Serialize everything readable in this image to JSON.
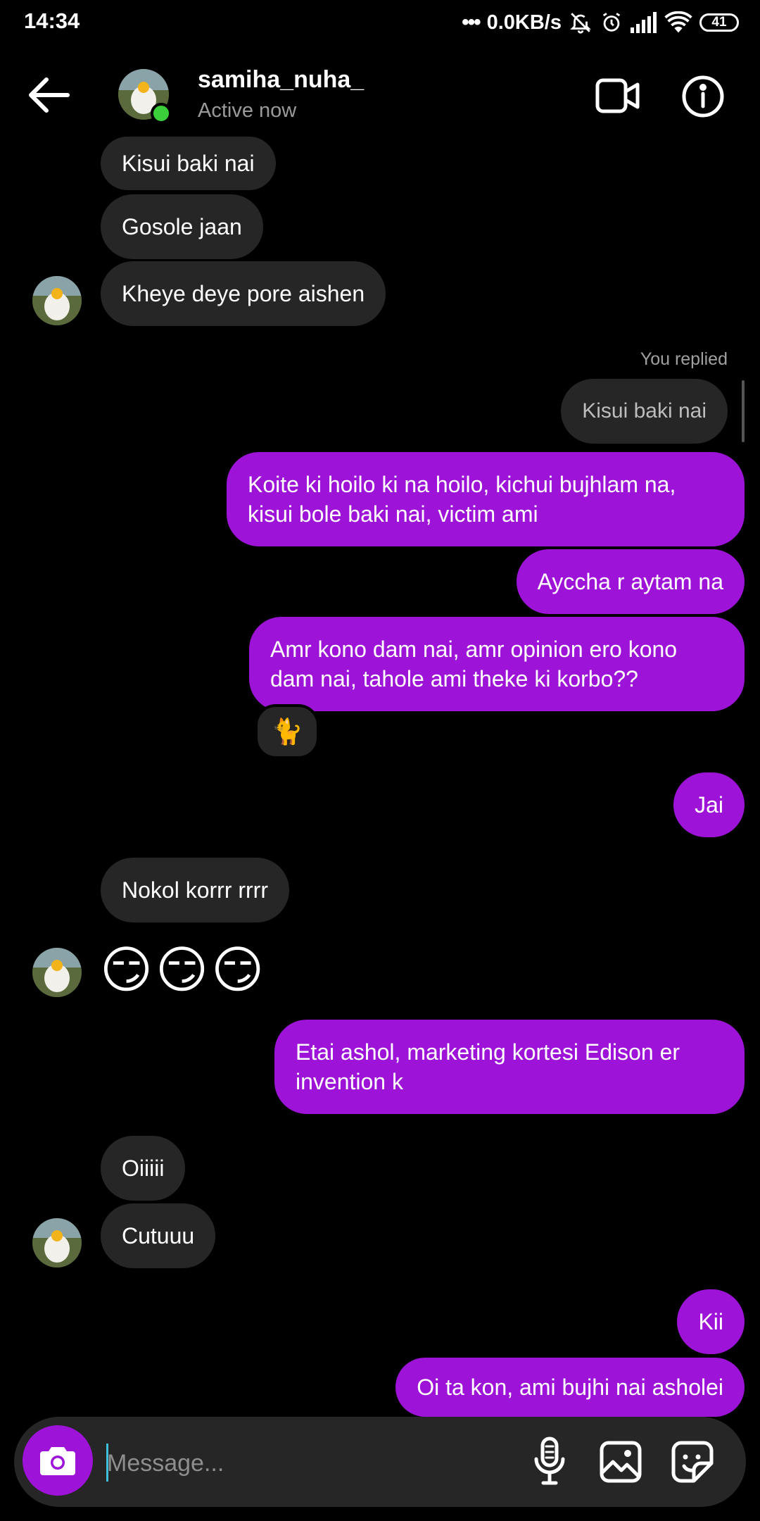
{
  "status_bar": {
    "time": "14:34",
    "network_speed": "0.0KB/s",
    "battery": "41"
  },
  "header": {
    "username": "samiha_nuha_",
    "status": "Active now",
    "icons": [
      "back-arrow-icon",
      "video-call-icon",
      "info-icon"
    ]
  },
  "messages": {
    "in_1": "Kisui baki nai",
    "in_2": "Gosole jaan",
    "in_3": "Kheye deye pore aishen",
    "reply_label": "You replied",
    "reply_quote": "Kisui baki nai",
    "out_1": "Koite ki hoilo ki na hoilo, kichui bujhlam na, kisui bole baki nai, victim ami",
    "out_2": "Ayccha r aytam na",
    "out_3": "Amr kono dam nai, amr opinion ero kono dam nai, tahole ami theke ki korbo??",
    "reaction": "🐈",
    "out_4": "Jai",
    "in_4": "Nokol korrr rrrr",
    "in_5_emoji": "😏😏😏",
    "out_5": "Etai ashol, marketing kortesi Edison er invention k",
    "in_6": "Oiiiii",
    "in_7": "Cutuuu",
    "out_6": "Kii",
    "out_7": "Oi ta kon, ami bujhi nai asholei"
  },
  "composer": {
    "placeholder": "Message...",
    "icons": [
      "camera-icon",
      "microphone-icon",
      "gallery-icon",
      "sticker-icon"
    ]
  },
  "colors": {
    "outgoing_bubble": "#9d13d8",
    "incoming_bubble": "#262626",
    "background": "#000000",
    "online": "#3ccf3c"
  }
}
